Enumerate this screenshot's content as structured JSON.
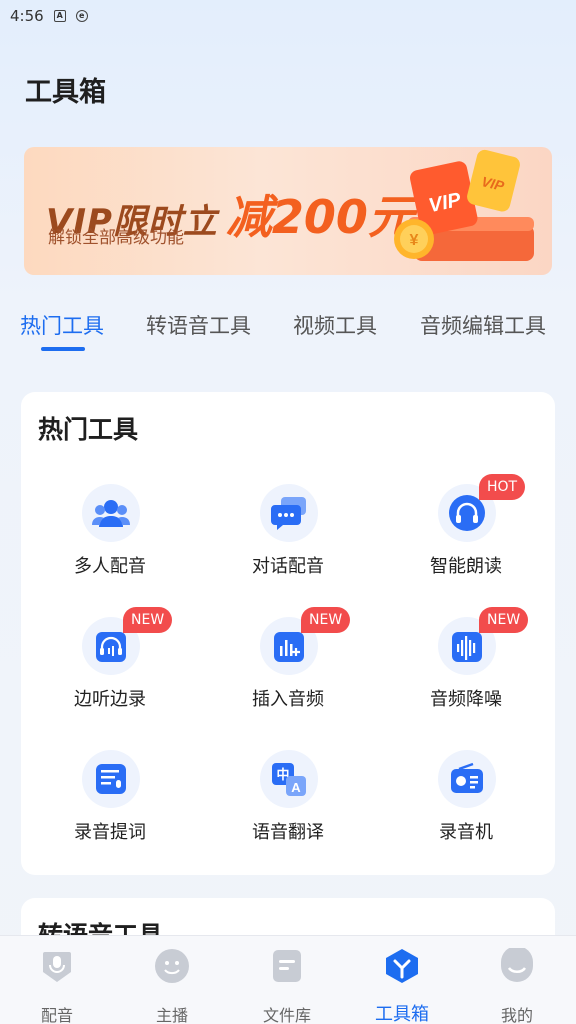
{
  "status_bar": {
    "time": "4:56"
  },
  "page_title": "工具箱",
  "banner": {
    "vip_text": "VIP限时立",
    "discount_text": "减200元",
    "subtitle": "解锁全部高级功能",
    "art_vip": "VIP",
    "art_coin": "¥"
  },
  "tabs": [
    {
      "label": "热门工具",
      "active": true
    },
    {
      "label": "转语音工具",
      "active": false
    },
    {
      "label": "视频工具",
      "active": false
    },
    {
      "label": "音频编辑工具",
      "active": false
    }
  ],
  "hot_section": {
    "title": "热门工具",
    "tools": [
      {
        "label": "多人配音",
        "icon": "multi-person-icon",
        "badge": ""
      },
      {
        "label": "对话配音",
        "icon": "chat-bubble-icon",
        "badge": ""
      },
      {
        "label": "智能朗读",
        "icon": "headphones-icon",
        "badge": "HOT"
      },
      {
        "label": "边听边录",
        "icon": "headset-record-icon",
        "badge": "NEW"
      },
      {
        "label": "插入音频",
        "icon": "insert-audio-icon",
        "badge": "NEW"
      },
      {
        "label": "音频降噪",
        "icon": "waveform-icon",
        "badge": "NEW"
      },
      {
        "label": "录音提词",
        "icon": "teleprompter-icon",
        "badge": ""
      },
      {
        "label": "语音翻译",
        "icon": "translate-icon",
        "badge": ""
      },
      {
        "label": "录音机",
        "icon": "radio-recorder-icon",
        "badge": ""
      }
    ]
  },
  "second_section": {
    "title": "转语音工具"
  },
  "bottom_nav": [
    {
      "label": "配音",
      "icon": "mic-icon",
      "active": false
    },
    {
      "label": "主播",
      "icon": "smiley-icon",
      "active": false
    },
    {
      "label": "文件库",
      "icon": "folder-icon",
      "active": false
    },
    {
      "label": "工具箱",
      "icon": "toolbox-icon",
      "active": true
    },
    {
      "label": "我的",
      "icon": "profile-icon",
      "active": false
    }
  ],
  "colors": {
    "accent": "#1d6df0",
    "badge": "#f24c4c",
    "icon_blue": "#2a6df5",
    "discount_orange": "#f3601f"
  }
}
